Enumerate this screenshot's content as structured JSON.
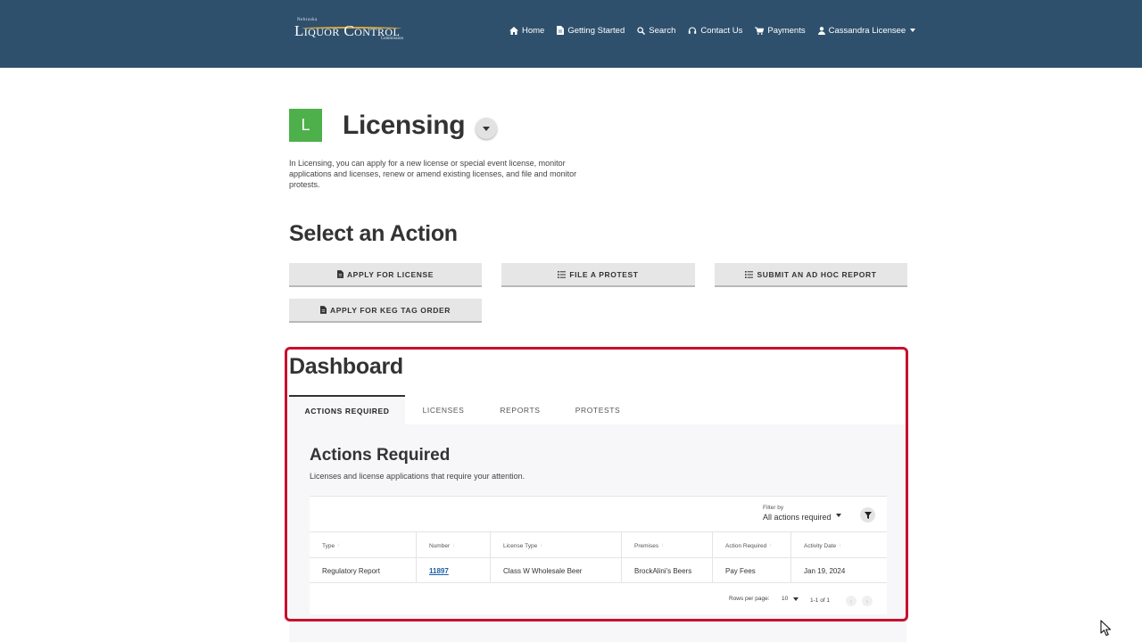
{
  "header": {
    "logo": {
      "top": "Nebraska",
      "main": "Liquor Control",
      "bottom": "Commission"
    },
    "nav": [
      {
        "label": "Home",
        "icon": "home-icon"
      },
      {
        "label": "Getting Started",
        "icon": "document-icon"
      },
      {
        "label": "Search",
        "icon": "search-icon"
      },
      {
        "label": "Contact Us",
        "icon": "headset-icon"
      },
      {
        "label": "Payments",
        "icon": "cart-icon"
      },
      {
        "label": "Cassandra Licensee",
        "icon": "user-icon"
      }
    ]
  },
  "licensing": {
    "badge": "L",
    "title": "Licensing",
    "description": "In Licensing, you can apply for a new license or special event license, monitor applications and licenses, renew or amend existing licenses, and file and monitor protests."
  },
  "actions": {
    "title": "Select an Action",
    "buttons": [
      {
        "label": "APPLY FOR LICENSE",
        "icon": "document-icon"
      },
      {
        "label": "FILE A PROTEST",
        "icon": "list-icon"
      },
      {
        "label": "SUBMIT AN AD HOC REPORT",
        "icon": "list-icon"
      },
      {
        "label": "APPLY FOR KEG TAG ORDER",
        "icon": "document-icon"
      }
    ]
  },
  "dashboard": {
    "title": "Dashboard",
    "tabs": [
      "ACTIONS REQUIRED",
      "LICENSES",
      "REPORTS",
      "PROTESTS"
    ],
    "active_tab": "ACTIONS REQUIRED",
    "panel_title": "Actions Required",
    "panel_subtitle": "Licenses and license applications that require your attention.",
    "filter_label": "Filter by",
    "filter_value": "All actions required",
    "columns": [
      "Type",
      "Number",
      "License Type",
      "Premises",
      "Action Required",
      "Activity Date"
    ],
    "rows": [
      [
        "Regulatory Report",
        "11897",
        "Class W Wholesale Beer",
        "BrockAlini's Beers",
        "Pay Fees",
        "Jan 19, 2024"
      ]
    ],
    "pagination": {
      "rows_per_page_label": "Rows per page:",
      "rows_per_page": "10",
      "range": "1-1 of 1"
    }
  },
  "colors": {
    "header_bg": "#2e506d",
    "badge_green": "#4db04a",
    "highlight_red": "#c8102e",
    "link_blue": "#1a5fa6"
  }
}
